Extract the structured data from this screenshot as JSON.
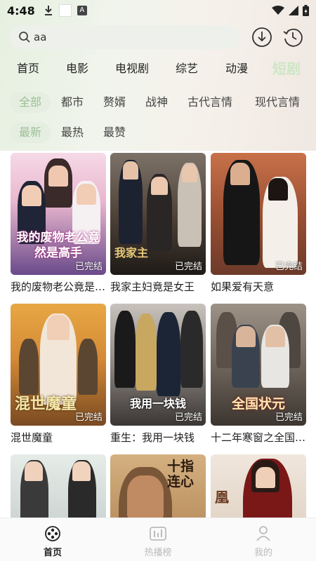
{
  "status_bar": {
    "time": "4:48"
  },
  "search": {
    "value": "aa"
  },
  "category_tabs": [
    "首页",
    "电影",
    "电视剧",
    "综艺",
    "动漫",
    "短剧"
  ],
  "active_category": "短剧",
  "genre_filters": [
    "全部",
    "都市",
    "赘婿",
    "战神",
    "古代言情",
    "现代言情"
  ],
  "active_genre": "全部",
  "sort_filters": [
    "最新",
    "最热",
    "最赞"
  ],
  "active_sort": "最新",
  "dramas": [
    {
      "title": "我的废物老公竟是高手",
      "poster_text": "我的废物老公竟然是高手",
      "status": "已完结"
    },
    {
      "title": "我家主妇竟是女王",
      "poster_text": "我家主",
      "status": "已完结"
    },
    {
      "title": "如果爱有天意",
      "poster_text": "",
      "status": "已完结"
    },
    {
      "title": "混世魔童",
      "poster_text": "混世魔童",
      "status": "已完结"
    },
    {
      "title": "重生：我用一块钱",
      "poster_text": "我用一块钱",
      "status": "已完结"
    },
    {
      "title": "十二年寒窗之全国状元",
      "poster_text": "全国状元",
      "status": "已完结"
    },
    {
      "title": "",
      "poster_text": "",
      "status": ""
    },
    {
      "title": "",
      "poster_text": "十指连心",
      "status": ""
    },
    {
      "title": "",
      "poster_text": "凰",
      "status": ""
    }
  ],
  "bottom_nav": [
    {
      "label": "首页",
      "icon": "film-reel-icon"
    },
    {
      "label": "热播榜",
      "icon": "chart-icon"
    },
    {
      "label": "我的",
      "icon": "person-icon"
    }
  ],
  "colors": {
    "accent": "#9bc094",
    "active_tab": "#cfe6c6"
  }
}
